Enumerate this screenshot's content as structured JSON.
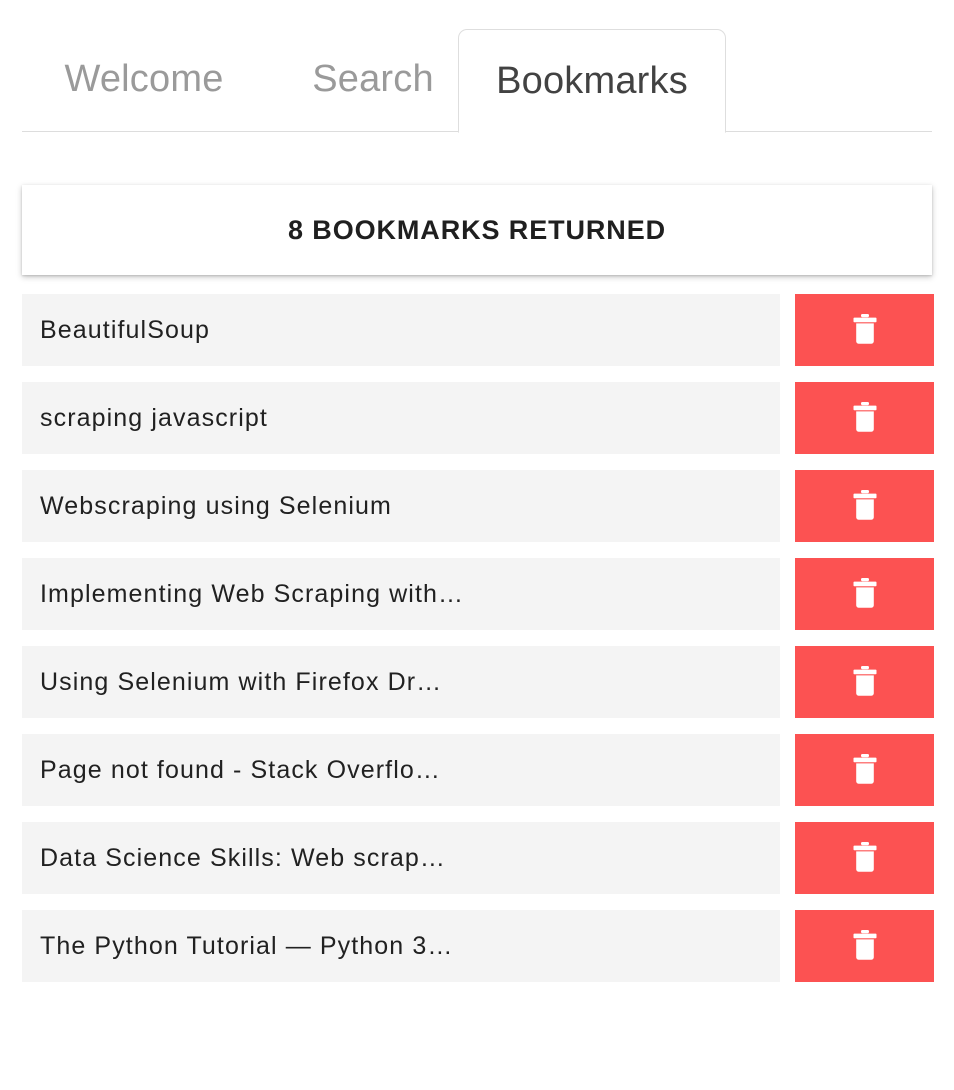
{
  "tabs": [
    {
      "label": "Welcome",
      "name": "tab-welcome",
      "active": false
    },
    {
      "label": "Search",
      "name": "tab-search",
      "active": false
    },
    {
      "label": "Bookmarks",
      "name": "tab-bookmarks",
      "active": true
    }
  ],
  "header": {
    "title": "8 BOOKMARKS RETURNED",
    "count": 8
  },
  "colors": {
    "delete_button": "#fc5252",
    "row_background": "#f4f4f4",
    "active_tab_text": "#424242",
    "inactive_tab_text": "#9a9a9a",
    "page_background": "#ffffff",
    "border": "#dedede"
  },
  "bookmarks": [
    {
      "title": "BeautifulSoup",
      "delete_icon": "trash-icon",
      "delete_label": ""
    },
    {
      "title": "scraping javascript",
      "delete_icon": "trash-icon",
      "delete_label": ""
    },
    {
      "title": "Webscraping using Selenium",
      "delete_icon": "trash-icon",
      "delete_label": ""
    },
    {
      "title": "Implementing Web Scraping with…",
      "delete_icon": "trash-icon",
      "delete_label": ""
    },
    {
      "title": "Using Selenium with Firefox Dr…",
      "delete_icon": "trash-icon",
      "delete_label": ""
    },
    {
      "title": "Page not found - Stack Overflo…",
      "delete_icon": "trash-icon",
      "delete_label": ""
    },
    {
      "title": "Data Science Skills: Web scrap…",
      "delete_icon": "trash-icon",
      "delete_label": ""
    },
    {
      "title": "The Python Tutorial — Python 3…",
      "delete_icon": "trash-icon",
      "delete_label": ""
    }
  ]
}
